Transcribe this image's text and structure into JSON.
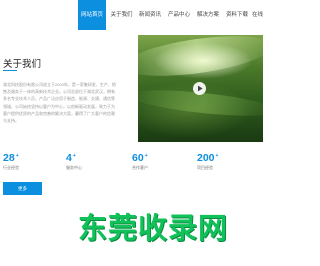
{
  "nav": {
    "items": [
      {
        "label": "网站首页",
        "active": true
      },
      {
        "label": "关于我们",
        "active": false
      },
      {
        "label": "新闻资讯",
        "active": false
      },
      {
        "label": "产品中心",
        "active": false
      },
      {
        "label": "解决方案",
        "active": false
      },
      {
        "label": "资料下载",
        "active": false
      },
      {
        "label": "在线",
        "active": false
      }
    ]
  },
  "about": {
    "title": "关于我们",
    "body": "湖北科技股份有限公司成立于2003年，是一家集研发、生产、销售及服务于一体的高新技术企业。公司总部位于湖北武汉，拥有多名专业技术人员，产品广泛应用于制造、能源、交通、通信等领域。公司始终坚持以客户为中心，以创新驱动发展，致力于为客户提供优质的产品和完善的解决方案，赢得了广大客户的信赖与支持。",
    "more_label": "更多"
  },
  "stats": [
    {
      "number": "28",
      "suffix": "+",
      "label": "行业经验"
    },
    {
      "number": "4",
      "suffix": "+",
      "label": "服务中心"
    },
    {
      "number": "60",
      "suffix": "+",
      "label": "合作客户"
    },
    {
      "number": "200",
      "suffix": "+",
      "label": "项目经验"
    }
  ],
  "watermark": {
    "text": "东莞收录网"
  },
  "colors": {
    "accent": "#0d8fe0",
    "watermark": "#11c15a"
  },
  "icons": {
    "play": "play-icon"
  }
}
